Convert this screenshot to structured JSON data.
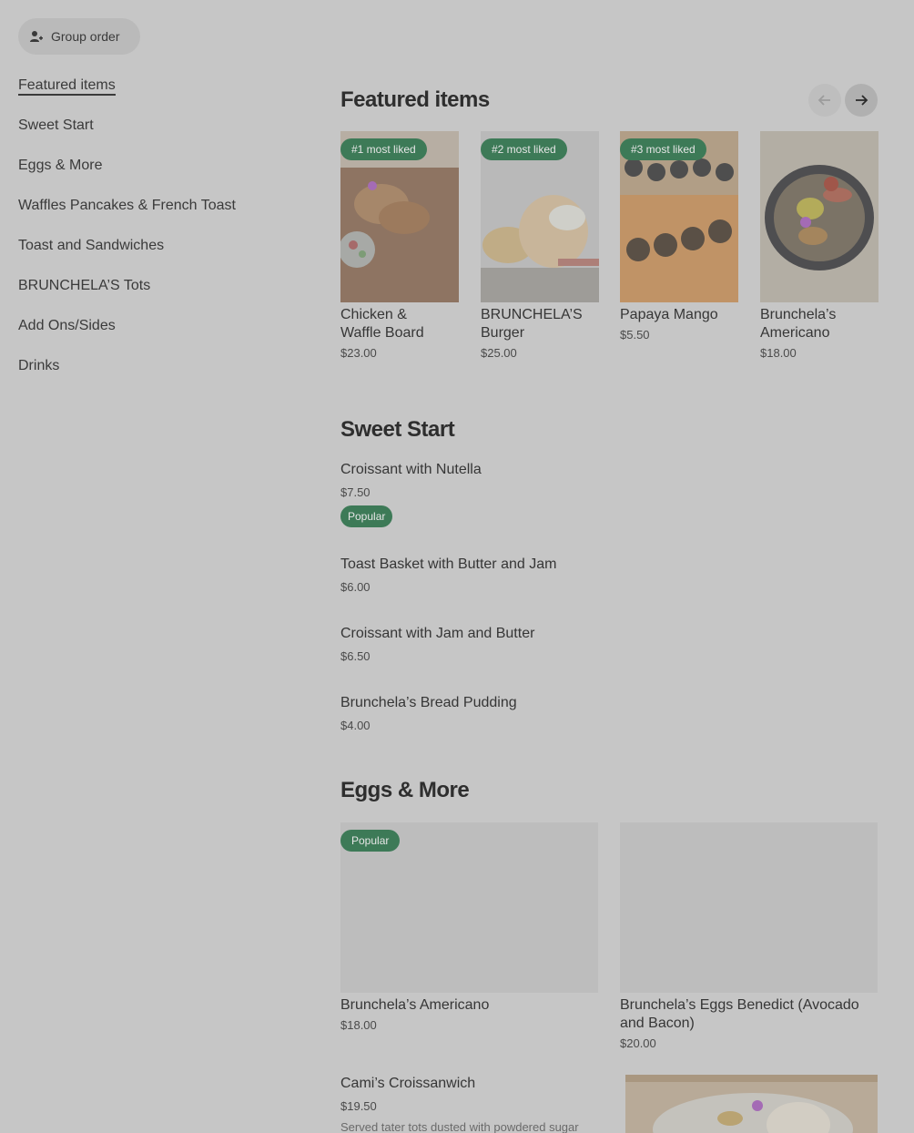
{
  "group_order": {
    "label": "Group order",
    "icon": "person-add-icon"
  },
  "sidebar": {
    "items": [
      {
        "label": "Featured items"
      },
      {
        "label": "Sweet Start"
      },
      {
        "label": "Eggs & More"
      },
      {
        "label": "Waffles Pancakes & French Toast"
      },
      {
        "label": "Toast and Sandwiches"
      },
      {
        "label": "BRUNCHELA’S Tots"
      },
      {
        "label": "Add Ons/Sides"
      },
      {
        "label": "Drinks"
      }
    ]
  },
  "featured": {
    "title": "Featured items",
    "prev_icon": "arrow-left-icon",
    "next_icon": "arrow-right-icon",
    "items": [
      {
        "badge": "#1 most liked",
        "name_line1": "Chicken &",
        "name_line2": "Waffle Board",
        "price": "$23.00"
      },
      {
        "badge": "#2 most liked",
        "name_line1": "BRUNCHELA’S",
        "name_line2": "Burger",
        "price": "$25.00"
      },
      {
        "badge": "#3 most liked",
        "name_line1": "Papaya Mango",
        "name_line2": "",
        "price": "$5.50"
      },
      {
        "badge": "",
        "name_line1": "Brunchela’s",
        "name_line2": "Americano",
        "price": "$18.00"
      }
    ]
  },
  "sweet_start": {
    "title": "Sweet Start",
    "items": [
      {
        "name": "Croissant with Nutella",
        "price": "$7.50",
        "badge": "Popular"
      },
      {
        "name": "Toast Basket with Butter and Jam",
        "price": "$6.00"
      },
      {
        "name": "Croissant with Jam and Butter",
        "price": "$6.50"
      },
      {
        "name": "Brunchela’s Bread Pudding",
        "price": "$4.00"
      }
    ]
  },
  "eggs_more": {
    "title": "Eggs & More",
    "cards": [
      {
        "badge": "Popular",
        "name_line1": "Brunchela’s Americano",
        "name_line2": "",
        "price": "$18.00"
      },
      {
        "badge": "",
        "name_line1": "Brunchela’s Eggs Benedict (Avocado",
        "name_line2": "and Bacon)",
        "price": "$20.00"
      }
    ],
    "list_item": {
      "name": "Cami’s Croissanwich",
      "price": "$19.50",
      "description": "Served tater tots dusted with powdered sugar"
    }
  },
  "colors": {
    "background": "#c6c6c6",
    "badge_green": "#3d7a57"
  }
}
